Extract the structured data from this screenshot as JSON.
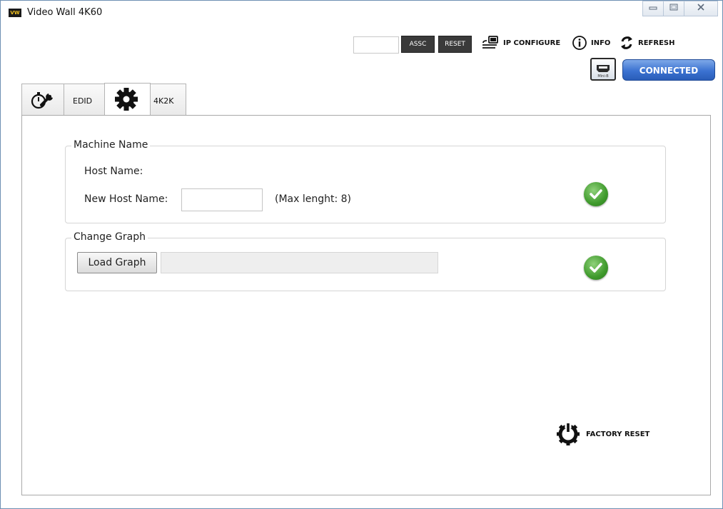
{
  "window": {
    "title": "Video Wall 4K60",
    "logo_text": "VW"
  },
  "toolbar": {
    "input_value": "",
    "assc_label": "ASSC",
    "reset_label": "RESET",
    "ip_configure_label": "IP CONFIGURE",
    "info_label": "INFO",
    "refresh_label": "REFRESH",
    "connection_status": "CONNECTED",
    "usb_label": "Mini-B"
  },
  "tabs": {
    "edid_label": "EDID",
    "k4k2_label": "4K2K",
    "active": "settings"
  },
  "machine_name": {
    "title": "Machine Name",
    "host_name_label": "Host Name:",
    "host_name_value": "",
    "new_host_name_label": "New Host Name:",
    "new_host_name_value": "",
    "max_hint": "(Max lenght: 8)"
  },
  "change_graph": {
    "title": "Change Graph",
    "load_button_label": "Load Graph",
    "path_value": ""
  },
  "factory_reset_label": "FACTORY RESET",
  "colors": {
    "accent_blue": "#3b72d1",
    "check_green": "#3f9a2c",
    "dark_button": "#3a3a3a"
  }
}
